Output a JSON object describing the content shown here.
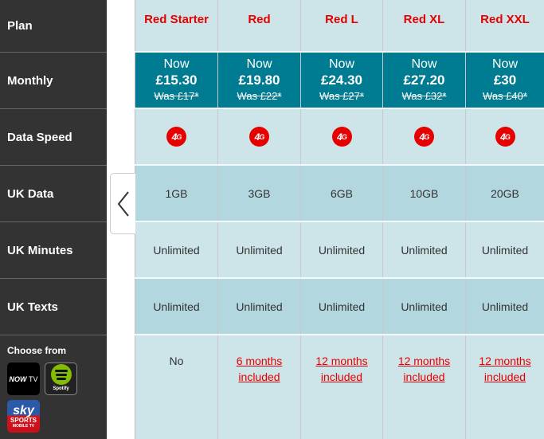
{
  "row_labels": {
    "plan": "Plan",
    "monthly": "Monthly",
    "data_speed": "Data Speed",
    "uk_data": "UK Data",
    "uk_minutes": "UK Minutes",
    "uk_texts": "UK Texts",
    "choose_from": "Choose from"
  },
  "partner_logos": [
    {
      "name": "NOW TV",
      "brand": "NOW",
      "suffix": "TV"
    },
    {
      "name": "Spotify",
      "label": "Spotify"
    },
    {
      "name": "Sky Sports Mobile TV",
      "line1": "sky",
      "line2": "SPORTS",
      "line3": "MOBILE TV"
    }
  ],
  "plans": [
    {
      "name": "Red Starter",
      "now_label": "Now",
      "price": "£15.30",
      "was": "Was £17*",
      "speed": "4G",
      "data": "1GB",
      "minutes": "Unlimited",
      "texts": "Unlimited",
      "extra_line1": "No",
      "extra_line2": "",
      "extra_is_link": false
    },
    {
      "name": "Red",
      "now_label": "Now",
      "price": "£19.80",
      "was": "Was £22*",
      "speed": "4G",
      "data": "3GB",
      "minutes": "Unlimited",
      "texts": "Unlimited",
      "extra_line1": "6 months",
      "extra_line2": "included",
      "extra_is_link": true
    },
    {
      "name": "Red L",
      "now_label": "Now",
      "price": "£24.30",
      "was": "Was £27*",
      "speed": "4G",
      "data": "6GB",
      "minutes": "Unlimited",
      "texts": "Unlimited",
      "extra_line1": "12 months",
      "extra_line2": "included",
      "extra_is_link": true
    },
    {
      "name": "Red XL",
      "now_label": "Now",
      "price": "£27.20",
      "was": "Was £32*",
      "speed": "4G",
      "data": "10GB",
      "minutes": "Unlimited",
      "texts": "Unlimited",
      "extra_line1": "12 months",
      "extra_line2": "included",
      "extra_is_link": true
    },
    {
      "name": "Red XXL",
      "now_label": "Now",
      "price": "£30",
      "was": "Was £40*",
      "speed": "4G",
      "data": "20GB",
      "minutes": "Unlimited",
      "texts": "Unlimited",
      "extra_line1": "12 months",
      "extra_line2": "included",
      "extra_is_link": true
    }
  ],
  "colors": {
    "brand_red": "#e60000",
    "teal": "#007c92",
    "sidebar_bg": "#333333",
    "row_light": "#cde4e8",
    "row_dark": "#b2d7de"
  },
  "nav": {
    "prev_icon": "chevron-left-icon"
  }
}
